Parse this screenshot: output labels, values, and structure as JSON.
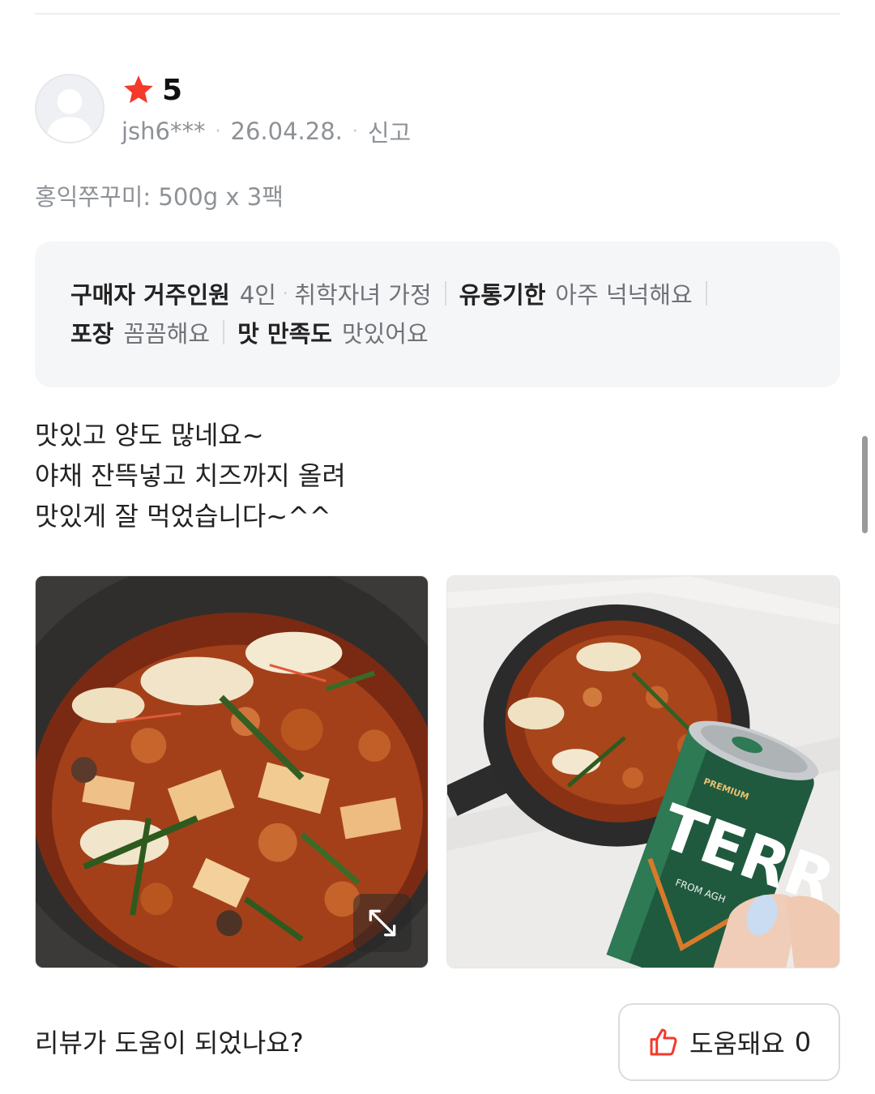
{
  "review": {
    "rating": "5",
    "user": "jsh6***",
    "date": "26.04.28.",
    "report_label": "신고",
    "option": "홍익쭈꾸미: 500g x 3팩",
    "attributes": [
      {
        "key": "구매자 거주인원",
        "value": "4인",
        "sub": "취학자녀 가정"
      },
      {
        "key": "유통기한",
        "value": "아주 넉넉해요"
      },
      {
        "key": "포장",
        "value": "꼼꼼해요"
      },
      {
        "key": "맛 만족도",
        "value": "맛있어요"
      }
    ],
    "body_lines": [
      "맛있고 양도 많네요~",
      "야채 잔뜩넣고 치즈까지 올려",
      "맛있게 잘 먹었습니다~^^"
    ]
  },
  "photos": {
    "photo_1": "food-photo",
    "photo_2": "food-with-beer-photo",
    "can_text": "TERR",
    "can_small": "FROM AGH",
    "can_premium": "PREMIUM"
  },
  "helpful": {
    "question": "리뷰가 도움이 되었나요?",
    "button_label": "도움돼요",
    "count": "0"
  },
  "colors": {
    "star": "#f5392b",
    "thumb": "#f5392b"
  }
}
